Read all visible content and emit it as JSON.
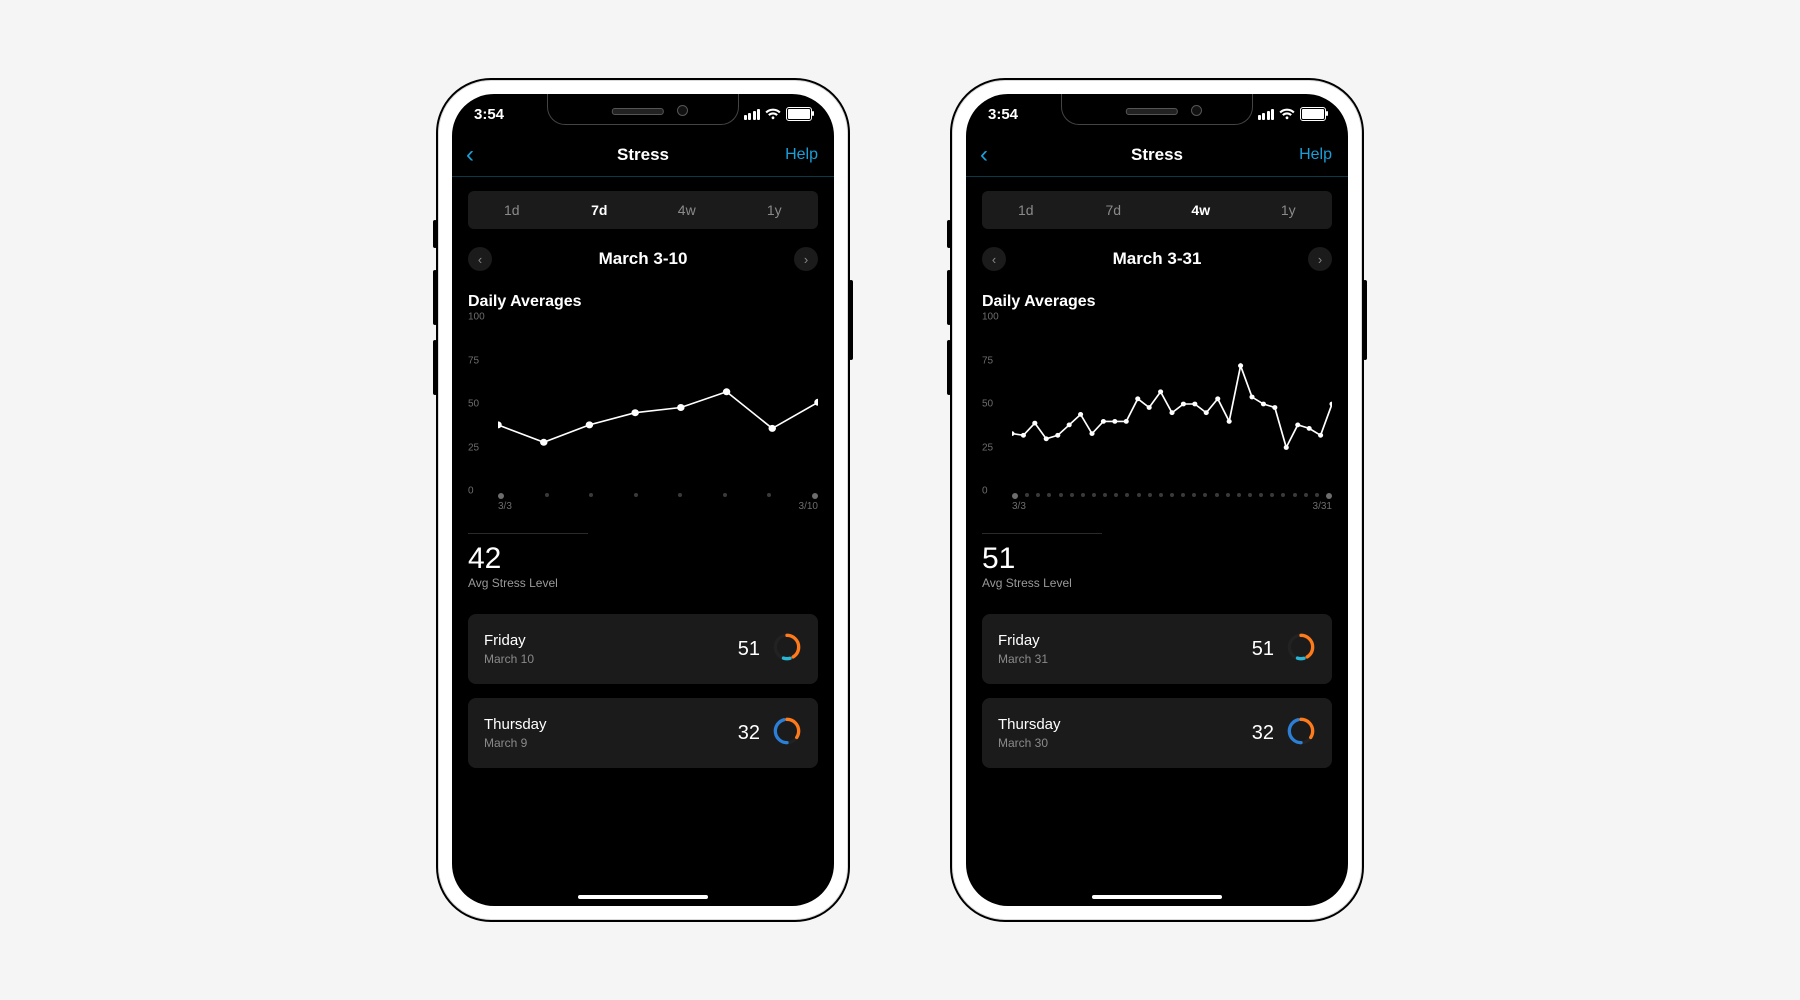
{
  "status": {
    "time": "3:54"
  },
  "nav": {
    "title": "Stress",
    "help": "Help"
  },
  "segments": [
    "1d",
    "7d",
    "4w",
    "1y"
  ],
  "chart_axis": {
    "yticks": [
      0,
      25,
      50,
      75,
      100
    ]
  },
  "phones": [
    {
      "active_segment": "7d",
      "range": "March 3-10",
      "xlab_left": "3/3",
      "xlab_right": "3/10",
      "section": "Daily Averages",
      "avg": "42",
      "avg_label": "Avg Stress Level",
      "n_points": 8,
      "cards": [
        {
          "day": "Friday",
          "date": "March 10",
          "val": "51",
          "ring": "orange+cyan"
        },
        {
          "day": "Thursday",
          "date": "March 9",
          "val": "32",
          "ring": "blue+orange"
        }
      ]
    },
    {
      "active_segment": "4w",
      "range": "March 3-31",
      "xlab_left": "3/3",
      "xlab_right": "3/31",
      "section": "Daily Averages",
      "avg": "51",
      "avg_label": "Avg Stress Level",
      "n_points": 29,
      "cards": [
        {
          "day": "Friday",
          "date": "March 31",
          "val": "51",
          "ring": "orange+cyan"
        },
        {
          "day": "Thursday",
          "date": "March 30",
          "val": "32",
          "ring": "blue+orange"
        }
      ]
    }
  ],
  "chart_data": [
    {
      "type": "line",
      "title": "Daily Averages",
      "ylabel": "Stress",
      "ylim": [
        0,
        100
      ],
      "x": [
        "3/3",
        "3/4",
        "3/5",
        "3/6",
        "3/7",
        "3/8",
        "3/9",
        "3/10"
      ],
      "values": [
        38,
        28,
        38,
        45,
        48,
        57,
        36,
        51
      ]
    },
    {
      "type": "line",
      "title": "Daily Averages",
      "ylabel": "Stress",
      "ylim": [
        0,
        100
      ],
      "x": [
        "3/3",
        "3/4",
        "3/5",
        "3/6",
        "3/7",
        "3/8",
        "3/9",
        "3/10",
        "3/11",
        "3/12",
        "3/13",
        "3/14",
        "3/15",
        "3/16",
        "3/17",
        "3/18",
        "3/19",
        "3/20",
        "3/21",
        "3/22",
        "3/23",
        "3/24",
        "3/25",
        "3/26",
        "3/27",
        "3/28",
        "3/29",
        "3/30",
        "3/31"
      ],
      "values": [
        33,
        32,
        39,
        30,
        32,
        38,
        44,
        33,
        40,
        40,
        40,
        53,
        48,
        57,
        45,
        50,
        50,
        45,
        53,
        40,
        72,
        54,
        50,
        48,
        25,
        38,
        36,
        32,
        50
      ]
    }
  ]
}
